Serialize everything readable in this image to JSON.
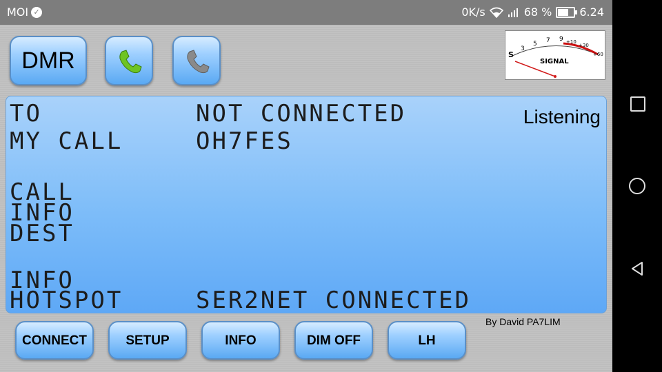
{
  "status_bar": {
    "carrier": "MOI",
    "speed": "0K/s",
    "battery": "68 %",
    "battery_level": 0.68,
    "time": "6.24"
  },
  "top_buttons": {
    "mode": "DMR",
    "call_icon": "phone-green-icon",
    "hangup_icon": "phone-gray-icon"
  },
  "meter": {
    "label": "SIGNAL",
    "scale": [
      "S",
      "3",
      "5",
      "7",
      "9",
      "+10",
      "+30",
      "+60"
    ]
  },
  "display": {
    "status": "Listening",
    "to_label": "TO",
    "to_value": "NOT CONNECTED",
    "mycall_label": "MY CALL",
    "mycall_value": "OH7FES",
    "call_label": "CALL",
    "info_label": "INFO",
    "dest_label": "DEST",
    "info2_label": "INFO",
    "hotspot_label": "HOTSPOT",
    "hotspot_value": "SER2NET CONNECTED"
  },
  "credit": "By David PA7LIM",
  "bottom_buttons": {
    "connect": "CONNECT",
    "setup": "SETUP",
    "info": "INFO",
    "dim": "DIM OFF",
    "lh": "LH"
  },
  "colors": {
    "display_blue": "#7cbcf9",
    "button_blue": "#5aa9f3",
    "call_green": "#6ec423",
    "hangup_gray": "#8a8a8a",
    "needle_red": "#d11b1b"
  }
}
